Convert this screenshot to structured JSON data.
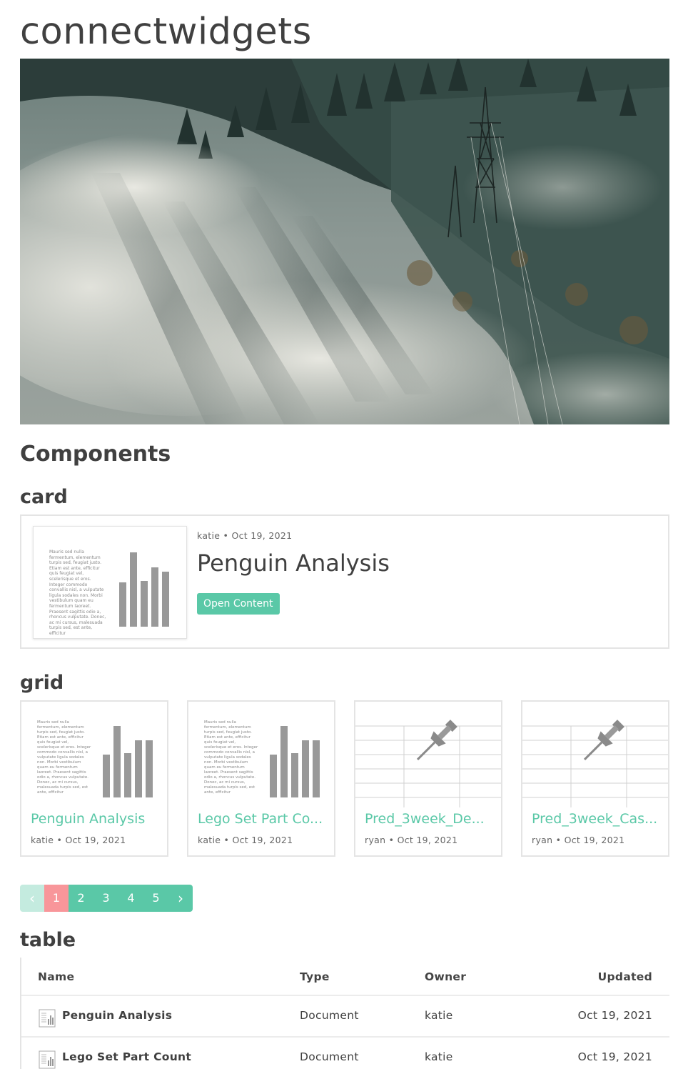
{
  "site": {
    "title": "connectwidgets"
  },
  "components": {
    "heading": "Components"
  },
  "card_section": {
    "heading": "card",
    "card": {
      "owner": "katie",
      "date": "Oct 19, 2021",
      "title": "Penguin Analysis",
      "button_label": "Open Content"
    }
  },
  "grid_section": {
    "heading": "grid",
    "items": [
      {
        "title": "Penguin Analysis",
        "owner": "katie",
        "date": "Oct 19, 2021",
        "thumb": "document-chart"
      },
      {
        "title": "Lego Set Part Co...",
        "owner": "katie",
        "date": "Oct 19, 2021",
        "thumb": "document-chart"
      },
      {
        "title": "Pred_3week_De...",
        "owner": "ryan",
        "date": "Oct 19, 2021",
        "thumb": "pin-table"
      },
      {
        "title": "Pred_3week_Cas...",
        "owner": "ryan",
        "date": "Oct 19, 2021",
        "thumb": "pin-table"
      }
    ]
  },
  "thumbnail_text": "Mauris sed nulla fermentum, elementum turpis sed, feugiat justo. Etiam est ante, efficitur quis feugiat vel, scelerisque et eros. Integer commodo convallis nisl, a vulputate ligula sodales non. Morbi vestibulum quam eu fermentum laoreet. Praesent sagittis odio a, rhoncus vulputate. Donec, ac mi cursus, malesuada turpis sed, est ante, efficitur",
  "pagination": {
    "prev": "‹",
    "next": "›",
    "pages": [
      "1",
      "2",
      "3",
      "4",
      "5"
    ],
    "current": "1"
  },
  "table_section": {
    "heading": "table",
    "columns": [
      "Name",
      "Type",
      "Owner",
      "Updated"
    ],
    "rows": [
      {
        "name": "Penguin Analysis",
        "type": "Document",
        "owner": "katie",
        "updated": "Oct 19, 2021"
      },
      {
        "name": "Lego Set Part Count",
        "type": "Document",
        "owner": "katie",
        "updated": "Oct 19, 2021"
      }
    ]
  },
  "colors": {
    "accent": "#5ac8a7",
    "active_page": "#f8969a",
    "bars": "#999999"
  }
}
